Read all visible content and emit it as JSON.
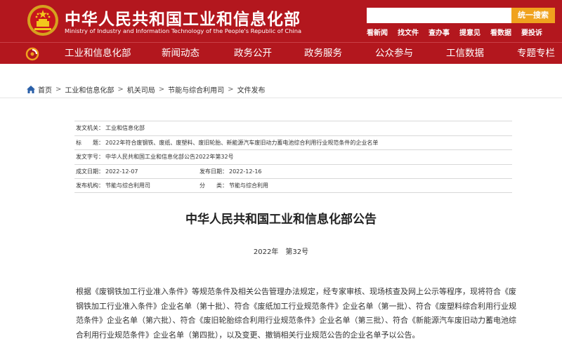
{
  "header": {
    "site_name_cn": "中华人民共和国工业和信息化部",
    "site_name_en": "Ministry of Industry and Information Technology of the People's Republic of China",
    "search_placeholder": "",
    "search_button": "统一搜索",
    "quick_links": [
      "看新闻",
      "找文件",
      "查办事",
      "提意见",
      "看数据",
      "要投诉"
    ]
  },
  "nav": {
    "items": [
      "工业和信息化部",
      "新闻动态",
      "政务公开",
      "政务服务",
      "公众参与",
      "工信数据",
      "专题专栏"
    ]
  },
  "breadcrumb": [
    "首页",
    "工业和信息化部",
    "机关司局",
    "节能与综合利用司",
    "文件发布"
  ],
  "meta": {
    "issuer_label": "发文机关：",
    "issuer": "工业和信息化部",
    "title_label": "标　　题：",
    "title": "2022年符合废钢铁、废纸、废塑料、废旧轮胎、新能源汽车废旧动力蓄电池综合利用行业规范条件的企业名单",
    "doc_no_label": "发文字号：",
    "doc_no": "中华人民共和国工业和信息化部公告2022年第32号",
    "written_label": "成文日期：",
    "written_date": "2022-12-07",
    "published_label": "发布日期：",
    "published_date": "2022-12-16",
    "agency_label": "发布机构：",
    "agency": "节能与综合利用司",
    "category_label": "分　　类：",
    "category": "节能与综合利用"
  },
  "document": {
    "title": "中华人民共和国工业和信息化部公告",
    "number": "2022年　第32号",
    "body": "根据《废钢铁加工行业准入条件》等规范条件及相关公告管理办法规定，经专家审核、现场核查及网上公示等程序，现将符合《废钢铁加工行业准入条件》企业名单（第十批）、符合《废纸加工行业规范条件》企业名单（第一批）、符合《废塑料综合利用行业规范条件》企业名单（第六批）、符合《废旧轮胎综合利用行业规范条件》企业名单（第三批）、符合《新能源汽车废旧动力蓄电池综合利用行业规范条件》企业名单（第四批），以及变更、撤销相关行业规范公告的企业名单予以公告。"
  },
  "colors": {
    "brand_red": "#b3171e",
    "search_button": "#f0a21e"
  }
}
